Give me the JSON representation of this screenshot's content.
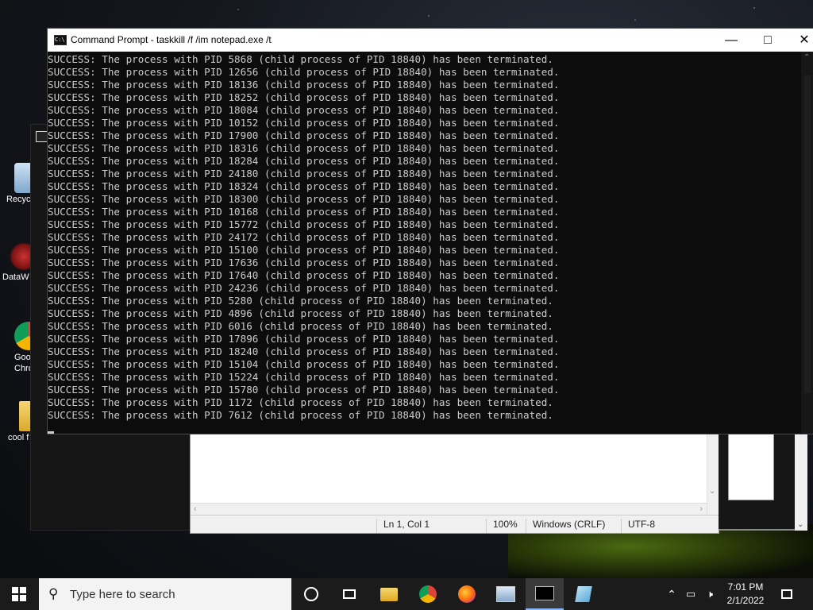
{
  "cmd": {
    "title": "Command Prompt - taskkill  /f /im notepad.exe /t",
    "output_lines": [
      "SUCCESS: The process with PID 5868 (child process of PID 18840) has been terminated.",
      "SUCCESS: The process with PID 12656 (child process of PID 18840) has been terminated.",
      "SUCCESS: The process with PID 18136 (child process of PID 18840) has been terminated.",
      "SUCCESS: The process with PID 18252 (child process of PID 18840) has been terminated.",
      "SUCCESS: The process with PID 18084 (child process of PID 18840) has been terminated.",
      "SUCCESS: The process with PID 10152 (child process of PID 18840) has been terminated.",
      "SUCCESS: The process with PID 17900 (child process of PID 18840) has been terminated.",
      "SUCCESS: The process with PID 18316 (child process of PID 18840) has been terminated.",
      "SUCCESS: The process with PID 18284 (child process of PID 18840) has been terminated.",
      "SUCCESS: The process with PID 24180 (child process of PID 18840) has been terminated.",
      "SUCCESS: The process with PID 18324 (child process of PID 18840) has been terminated.",
      "SUCCESS: The process with PID 18300 (child process of PID 18840) has been terminated.",
      "SUCCESS: The process with PID 10168 (child process of PID 18840) has been terminated.",
      "SUCCESS: The process with PID 15772 (child process of PID 18840) has been terminated.",
      "SUCCESS: The process with PID 24172 (child process of PID 18840) has been terminated.",
      "SUCCESS: The process with PID 15100 (child process of PID 18840) has been terminated.",
      "SUCCESS: The process with PID 17636 (child process of PID 18840) has been terminated.",
      "SUCCESS: The process with PID 17640 (child process of PID 18840) has been terminated.",
      "SUCCESS: The process with PID 24236 (child process of PID 18840) has been terminated.",
      "SUCCESS: The process with PID 5280 (child process of PID 18840) has been terminated.",
      "SUCCESS: The process with PID 4896 (child process of PID 18840) has been terminated.",
      "SUCCESS: The process with PID 6016 (child process of PID 18840) has been terminated.",
      "SUCCESS: The process with PID 17896 (child process of PID 18840) has been terminated.",
      "SUCCESS: The process with PID 18240 (child process of PID 18840) has been terminated.",
      "SUCCESS: The process with PID 15104 (child process of PID 18840) has been terminated.",
      "SUCCESS: The process with PID 15224 (child process of PID 18840) has been terminated.",
      "SUCCESS: The process with PID 15780 (child process of PID 18840) has been terminated.",
      "SUCCESS: The process with PID 1172 (child process of PID 18840) has been terminated.",
      "SUCCESS: The process with PID 7612 (child process of PID 18840) has been terminated."
    ],
    "icon_text": "C:\\"
  },
  "notepad": {
    "status_position": "Ln 1, Col 1",
    "status_zoom": "100%",
    "status_eol": "Windows (CRLF)",
    "status_encoding": "UTF-8"
  },
  "desktop_icons": [
    {
      "label": "Recyc",
      "icon": "recycle-bin-icon"
    },
    {
      "label": "DataW",
      "icon": "datawrapper-icon"
    },
    {
      "label": "Goo\nChro",
      "icon": "chrome-icon"
    },
    {
      "label": "cool f",
      "icon": "folder-icon"
    }
  ],
  "taskbar": {
    "search_placeholder": "Type here to search",
    "time": "7:01 PM",
    "date": "2/1/2022"
  }
}
